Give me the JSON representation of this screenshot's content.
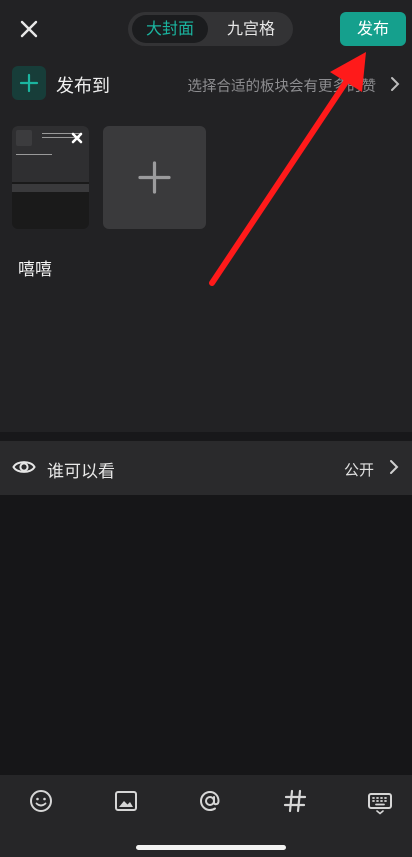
{
  "header": {
    "tabs": [
      "大封面",
      "九宫格"
    ],
    "active_tab": "大封面",
    "publish_label": "发布"
  },
  "publish_to": {
    "label": "发布到",
    "hint": "选择合适的板块会有更多的赞"
  },
  "post": {
    "caption": "嘻嘻"
  },
  "visibility": {
    "label": "谁可以看",
    "value": "公开"
  },
  "colors": {
    "accent": "#15a08d",
    "background": "#222224",
    "annotation": "#ff1a1a"
  },
  "icons": [
    "close-icon",
    "plus-icon",
    "chevron-right-icon",
    "eye-icon",
    "emoji-icon",
    "image-icon",
    "at-icon",
    "hashtag-icon",
    "keyboard-icon"
  ]
}
